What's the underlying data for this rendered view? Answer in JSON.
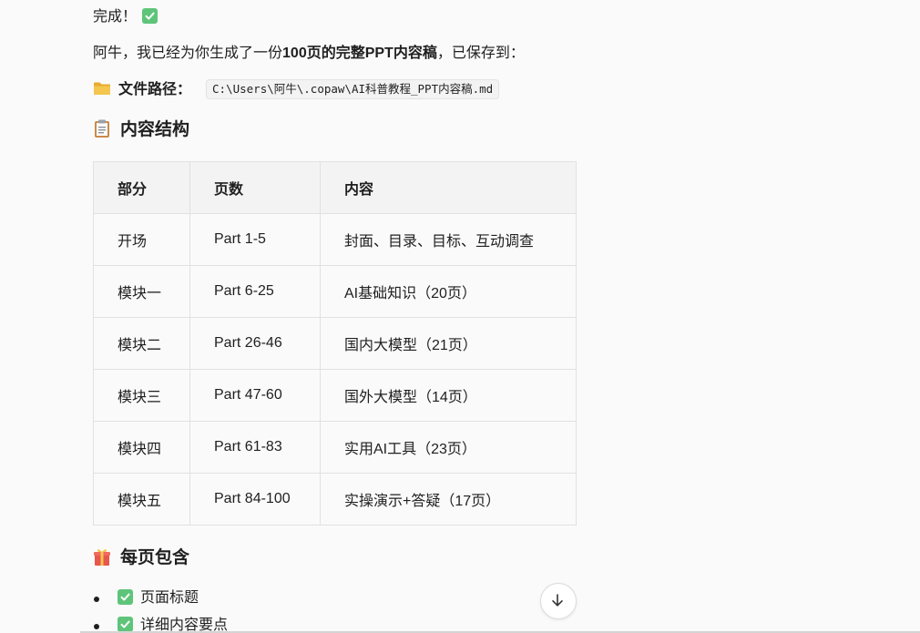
{
  "message": {
    "done_text": "完成！",
    "intro_prefix": "阿牛，我已经为你生成了一份",
    "intro_bold": "100页的完整PPT内容稿",
    "intro_suffix": "，已保存到：",
    "path_label": "文件路径：",
    "path_value": "C:\\Users\\阿牛\\.copaw\\AI科普教程_PPT内容稿.md"
  },
  "structure_section": {
    "title": "内容结构",
    "icon": "clipboard-icon",
    "headers": [
      "部分",
      "页数",
      "内容"
    ],
    "rows": [
      [
        "开场",
        "Part 1-5",
        "封面、目录、目标、互动调查"
      ],
      [
        "模块一",
        "Part 6-25",
        "AI基础知识（20页）"
      ],
      [
        "模块二",
        "Part 26-46",
        "国内大模型（21页）"
      ],
      [
        "模块三",
        "Part 47-60",
        "国外大模型（14页）"
      ],
      [
        "模块四",
        "Part 61-83",
        "实用AI工具（23页）"
      ],
      [
        "模块五",
        "Part 84-100",
        "实操演示+答疑（17页）"
      ]
    ]
  },
  "perpage_section": {
    "title": "每页包含",
    "icon": "gift-icon",
    "items": [
      "页面标题",
      "详细内容要点"
    ]
  },
  "icons": {
    "check": "check-mark-icon",
    "folder": "folder-icon",
    "scroll": "arrow-down-icon"
  },
  "colors": {
    "check_green": "#5ec47a",
    "folder_yellow": "#f4c64e",
    "text": "#1f1f1f"
  }
}
